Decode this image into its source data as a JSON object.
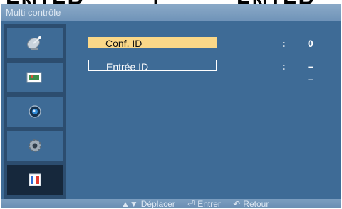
{
  "cropped_top_text": {
    "left": "ENTER",
    "middle": "]",
    "right": "ENTER"
  },
  "window": {
    "title": "Multi contrôle"
  },
  "sidebar": {
    "items": [
      {
        "icon": "satellite-dish-icon"
      },
      {
        "icon": "tv-screen-icon"
      },
      {
        "icon": "sound-icon"
      },
      {
        "icon": "settings-gear-icon"
      },
      {
        "icon": "multi-control-icon",
        "selected": true
      }
    ]
  },
  "menu": {
    "rows": [
      {
        "label": "Conf. ID",
        "separator": ":",
        "value": "0",
        "selected": true
      },
      {
        "label": "Entrée ID",
        "separator": ":",
        "value": "– –",
        "selected": false
      }
    ]
  },
  "footer": {
    "move": {
      "symbol": "▲▼",
      "label": "Déplacer"
    },
    "enter": {
      "symbol": "⏎",
      "label": "Entrer"
    },
    "back": {
      "symbol": "↶",
      "label": "Retour"
    }
  },
  "colors": {
    "panel": "#3e6b96",
    "sidebar": "#2c4d6f",
    "selected_row": "#fbd888",
    "selected_tab": "#16283c"
  }
}
